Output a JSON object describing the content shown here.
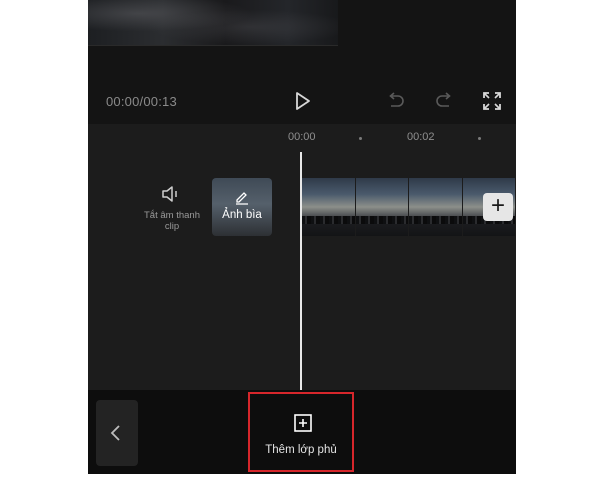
{
  "player": {
    "time_display": "00:00/00:13"
  },
  "timeline": {
    "ruler": {
      "labels": [
        "00:00",
        "00:02"
      ]
    },
    "mute": {
      "label_line1": "Tắt âm thanh",
      "label_line2": "clip",
      "icon": "speaker-icon"
    },
    "cover": {
      "label": "Ảnh bìa",
      "icon": "pencil-icon"
    },
    "add_clip": {
      "label": "+"
    }
  },
  "bottom_toolbar": {
    "back_icon": "chevron-left-icon",
    "add_overlay": {
      "label": "Thêm lớp phủ",
      "icon": "add-square-icon",
      "highlight_color": "#d6262b"
    }
  }
}
